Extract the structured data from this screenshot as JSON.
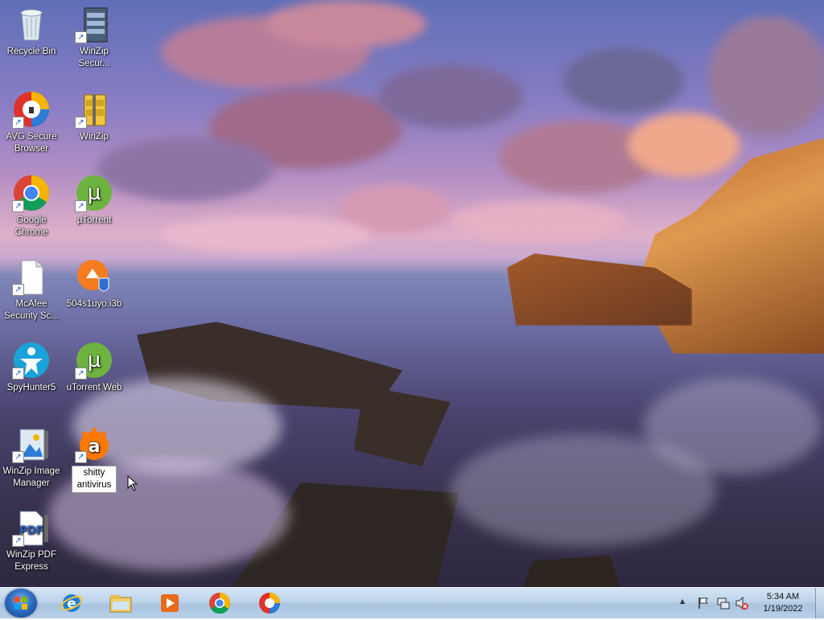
{
  "desktop": {
    "icons": [
      {
        "label": "Recycle Bin"
      },
      {
        "label": "WinZip Secur..."
      },
      {
        "label": "AVG Secure Browser"
      },
      {
        "label": "WinZip"
      },
      {
        "label": "Google Chrome"
      },
      {
        "label": "µTorrent"
      },
      {
        "label": "McAfee Security Sc..."
      },
      {
        "label": "504s1uyo.i3b"
      },
      {
        "label": "SpyHunter5"
      },
      {
        "label": "uTorrent Web"
      },
      {
        "label": "WinZip Image Manager"
      },
      {
        "label": "shitty antivirus"
      },
      {
        "label": "WinZip PDF Express"
      }
    ]
  },
  "taskbar": {
    "pinned": [
      {
        "icon": "internet-explorer-icon"
      },
      {
        "icon": "file-explorer-icon"
      },
      {
        "icon": "media-player-icon"
      },
      {
        "icon": "chrome-icon"
      },
      {
        "icon": "avg-browser-icon"
      }
    ],
    "tray": {
      "show_hidden": "▲",
      "time": "5:34 AM",
      "date": "1/19/2022"
    }
  },
  "colors": {
    "taskbar": "#b9d0e8",
    "accent": "#2f6fc4"
  }
}
